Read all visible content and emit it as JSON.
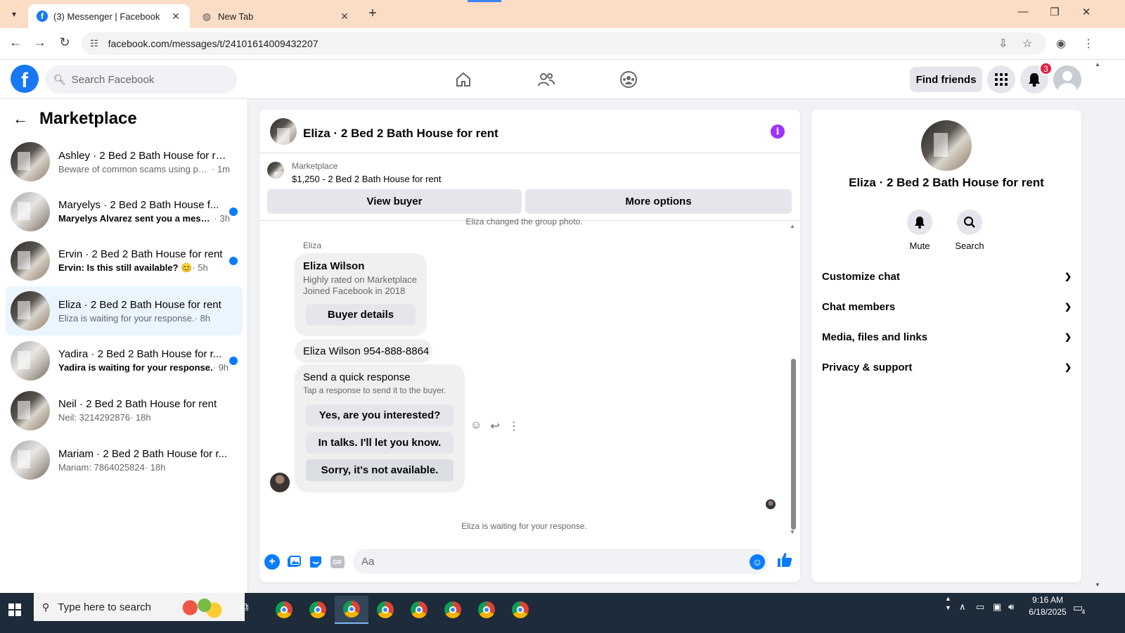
{
  "browser": {
    "tabs": [
      {
        "title": "(3) Messenger | Facebook",
        "active": true
      },
      {
        "title": "New Tab",
        "active": false
      }
    ],
    "url": "facebook.com/messages/t/24101614009432207"
  },
  "header": {
    "search_placeholder": "Search Facebook",
    "find_friends": "Find friends",
    "notification_count": "3"
  },
  "sidebar": {
    "title": "Marketplace",
    "conversations": [
      {
        "name": "Ashley · 2 Bed 2 Bath House for rent",
        "message": "Beware of common scams using pay...",
        "time": " · 1m",
        "unread": false,
        "active": false,
        "thumb": "dark"
      },
      {
        "name": "Maryelys · 2 Bed 2 Bath House f...",
        "message": "Maryelys Alvarez sent you a messa...",
        "time": " · 3h",
        "unread": true,
        "active": false,
        "thumb": "light"
      },
      {
        "name": "Ervin · 2 Bed 2 Bath House for rent",
        "message": "Ervin: Is this still available? 😊",
        "time": " · 5h",
        "unread": true,
        "active": false,
        "thumb": "dark"
      },
      {
        "name": "Eliza · 2 Bed 2 Bath House for rent",
        "message": "Eliza is waiting for your response.",
        "time": " · 8h",
        "unread": false,
        "active": true,
        "thumb": "dark"
      },
      {
        "name": "Yadira · 2 Bed 2 Bath House for r...",
        "message": "Yadira is waiting for your response.",
        "time": " · 9h",
        "unread": true,
        "active": false,
        "thumb": "light"
      },
      {
        "name": "Neil · 2 Bed 2 Bath House for rent",
        "message": "Neil: 3214292876",
        "time": " · 18h",
        "unread": false,
        "active": false,
        "thumb": "dark"
      },
      {
        "name": "Mariam · 2 Bed 2 Bath House for r...",
        "message": "Mariam: 7864025824",
        "time": " · 18h",
        "unread": false,
        "active": false,
        "thumb": "light"
      }
    ]
  },
  "chat": {
    "title": "Eliza · 2 Bed 2 Bath House for rent",
    "marketplace_label": "Marketplace",
    "listing": "$1,250 - 2 Bed 2 Bath House for rent",
    "view_buyer": "View buyer",
    "more_options": "More options",
    "system_top": "Eliza changed the group photo.",
    "sender": "Eliza",
    "buyer_card": {
      "name": "Eliza Wilson",
      "line1": "Highly rated on Marketplace",
      "line2": "Joined Facebook in 2018",
      "button": "Buyer details"
    },
    "phone_message": "Eliza Wilson 954-888-8864",
    "quick": {
      "title": "Send a quick response",
      "subtitle": "Tap a response to send it to the buyer.",
      "options": [
        "Yes, are you interested?",
        "In talks. I'll let you know.",
        "Sorry, it's not available."
      ]
    },
    "waiting": "Eliza is waiting for your response.",
    "composer_placeholder": "Aa"
  },
  "details": {
    "name": "Eliza · 2 Bed 2 Bath House for rent",
    "mute": "Mute",
    "search": "Search",
    "sections": [
      "Customize chat",
      "Chat members",
      "Media, files and links",
      "Privacy & support"
    ]
  },
  "taskbar": {
    "search_placeholder": "Type here to search",
    "time": "9:16 AM",
    "date": "6/18/2025",
    "notifications": "4"
  }
}
